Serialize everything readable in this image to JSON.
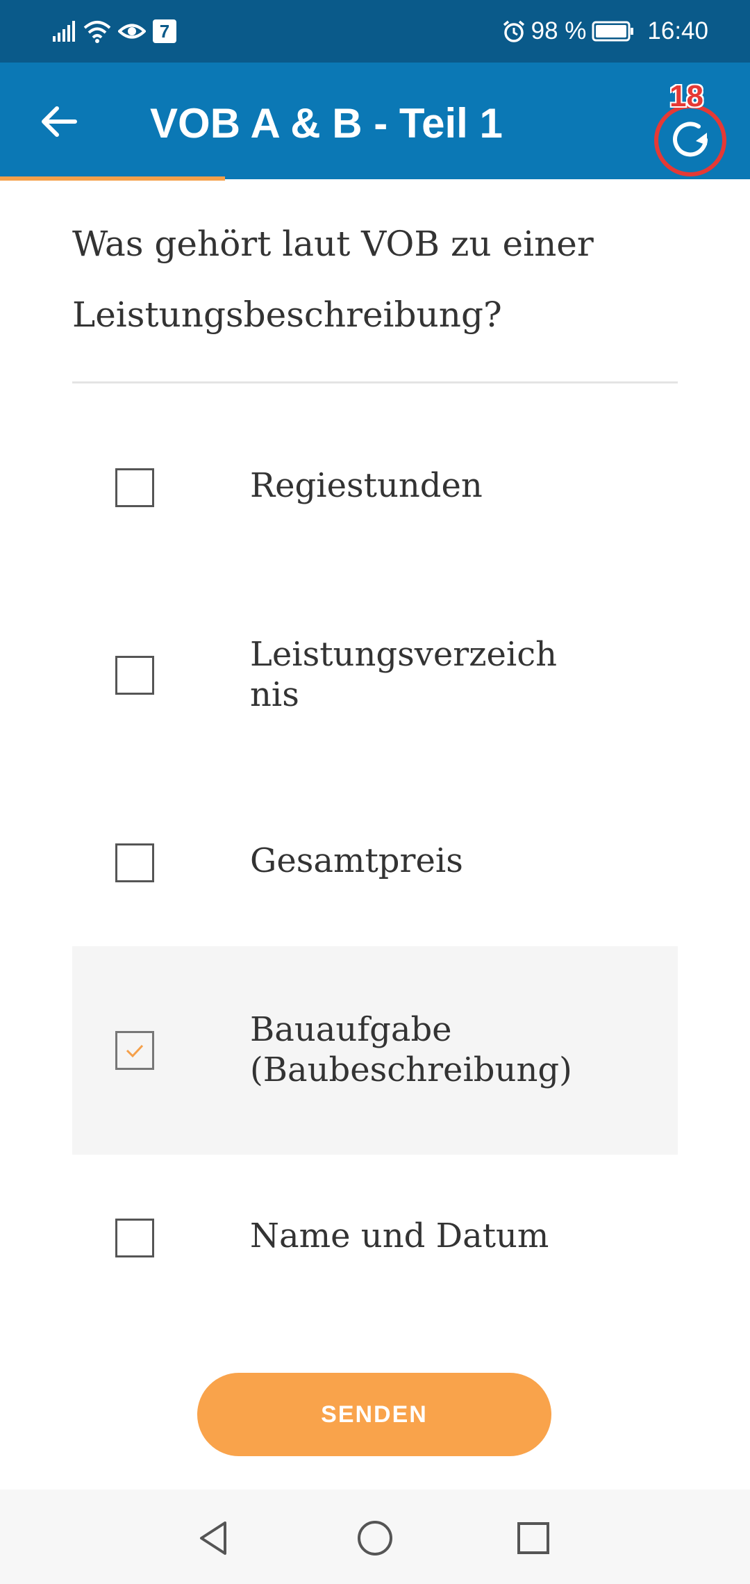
{
  "status_bar": {
    "calendar_day": "7",
    "battery": "98 %",
    "time": "16:40",
    "icons": [
      "signal-icon",
      "wifi-icon",
      "eye-icon",
      "calendar-icon",
      "alarm-icon",
      "battery-icon"
    ]
  },
  "app_bar": {
    "title": "VOB A & B - Teil 1",
    "back_icon": "arrow-left-icon",
    "refresh_icon": "refresh-icon",
    "refresh_count": "18",
    "colors": {
      "background": "#0b78b5",
      "badge": "#e53935"
    }
  },
  "progress": {
    "fraction": 0.3,
    "color": "#f5a04a"
  },
  "question": {
    "text": "Was gehört laut VOB zu einer Leistungsbeschreibung?"
  },
  "options": [
    {
      "label": "Regiestunden",
      "checked": false
    },
    {
      "label": "Leistungsverzeich nis",
      "checked": false
    },
    {
      "label": "Gesamtpreis",
      "checked": false
    },
    {
      "label": "Bauaufgabe (Baubeschreibung)",
      "checked": true
    },
    {
      "label": "Name und Datum",
      "checked": false
    }
  ],
  "send_button": {
    "label": "SENDEN",
    "color": "#f9a34b"
  },
  "nav_bar": {
    "icons": [
      "back-triangle-icon",
      "home-circle-icon",
      "recents-square-icon"
    ]
  }
}
